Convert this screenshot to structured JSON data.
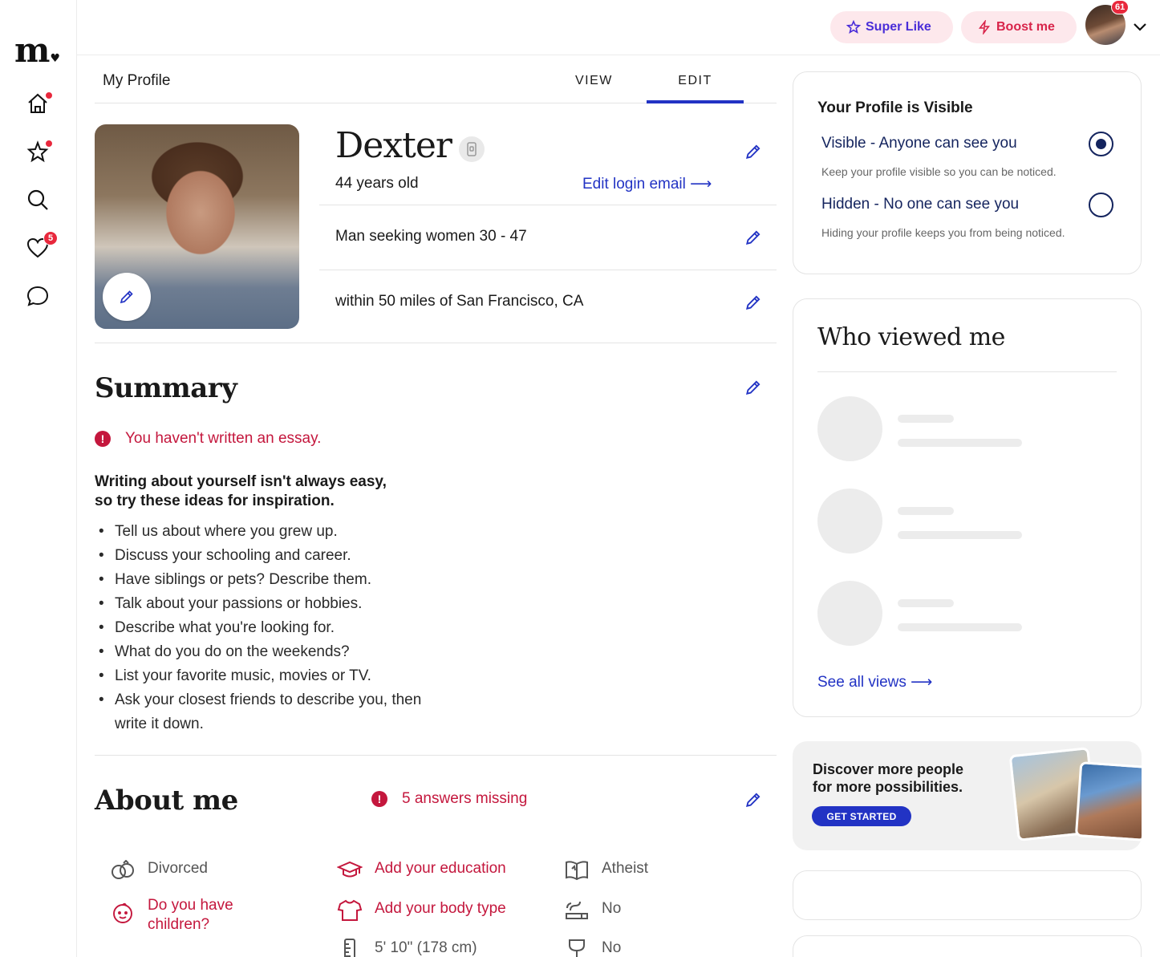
{
  "brand": {
    "logo_text": "m"
  },
  "nav": {
    "likes_badge": "5"
  },
  "topbar": {
    "super_like": "Super Like",
    "boost": "Boost me",
    "notifications_badge": "61"
  },
  "profile": {
    "section_title": "My Profile",
    "tabs": {
      "view": "VIEW",
      "edit": "EDIT",
      "active": "EDIT"
    },
    "name": "Dexter",
    "age": "44 years old",
    "edit_login_email": "Edit login email",
    "seeking": "Man seeking women 30 - 47",
    "location": "within 50 miles of San Francisco, CA"
  },
  "summary": {
    "title": "Summary",
    "warning": "You haven't written an essay.",
    "inspiration_line1": "Writing about yourself isn't always easy,",
    "inspiration_line2": "so try these ideas for inspiration.",
    "tips": [
      "Tell us about where you grew up.",
      "Discuss your schooling and career.",
      "Have siblings or pets? Describe them.",
      "Talk about your passions or hobbies.",
      "Describe what you're looking for.",
      "What do you do on the weekends?",
      "List your favorite music, movies or TV.",
      "Ask your closest friends to describe you, then write it down."
    ]
  },
  "about": {
    "title": "About me",
    "missing": "5 answers missing",
    "items": {
      "relationship": "Divorced",
      "education": "Add your education",
      "religion": "Atheist",
      "children_line1": "Do you have",
      "children_line2": "children?",
      "body_type": "Add your body type",
      "smoking": "No",
      "height": "5' 10\" (178 cm)",
      "drinking": "No"
    }
  },
  "visibility": {
    "title": "Your Profile is Visible",
    "visible_label": "Visible - Anyone can see you",
    "visible_desc": "Keep your profile visible so you can be noticed.",
    "hidden_label": "Hidden - No one can see you",
    "hidden_desc": "Hiding your profile keeps you from being noticed.",
    "selected": "visible"
  },
  "viewed": {
    "title": "Who viewed me",
    "see_all": "See all views"
  },
  "discover": {
    "line1": "Discover more people",
    "line2": "for more possibilities.",
    "cta": "GET STARTED"
  },
  "colors": {
    "accent_blue": "#2233c4",
    "alert_red": "#c4173d",
    "navy": "#14245e",
    "pink_pill": "#fde8ec"
  }
}
